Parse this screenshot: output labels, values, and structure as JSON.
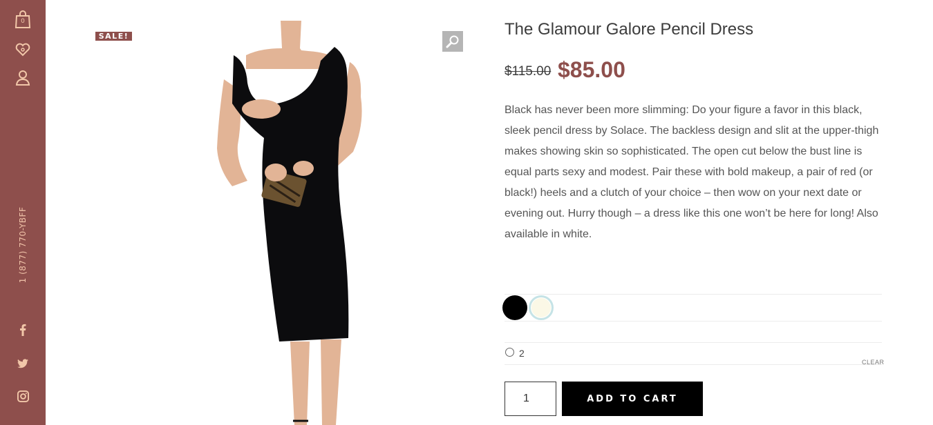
{
  "sidebar": {
    "cart_count": "0",
    "phone": "1 (877) 770-YBFF",
    "icons": [
      "shopping-bag-icon",
      "heart-icon",
      "user-icon",
      "facebook-icon",
      "twitter-icon",
      "instagram-icon"
    ]
  },
  "gallery": {
    "sale_badge": "SALE!",
    "zoom_icon": "magnifier-icon"
  },
  "product": {
    "title": "The Glamour Galore Pencil Dress",
    "old_price": "$115.00",
    "new_price": "$85.00",
    "description": "Black has never been more slimming: Do your figure a favor in this black, sleek pencil dress by Solace. The backless design and slit at the upper-thigh makes showing skin so sophisticated. The open cut below the bust line is equal parts sexy and modest. Pair these with bold makeup, a pair of red (or black!) heels and a clutch of your choice – then wow on your next date or evening out. Hurry though – a dress like this one won’t be here for long! Also available in white.",
    "colors": [
      "#000000",
      "#fbf8e6"
    ],
    "size_option": "2",
    "clear_label": "CLEAR",
    "quantity": "1",
    "add_to_cart": "ADD TO CART"
  },
  "theme": {
    "accent": "#8e4f4c",
    "sidebar_icon": "#f2c7a9"
  }
}
